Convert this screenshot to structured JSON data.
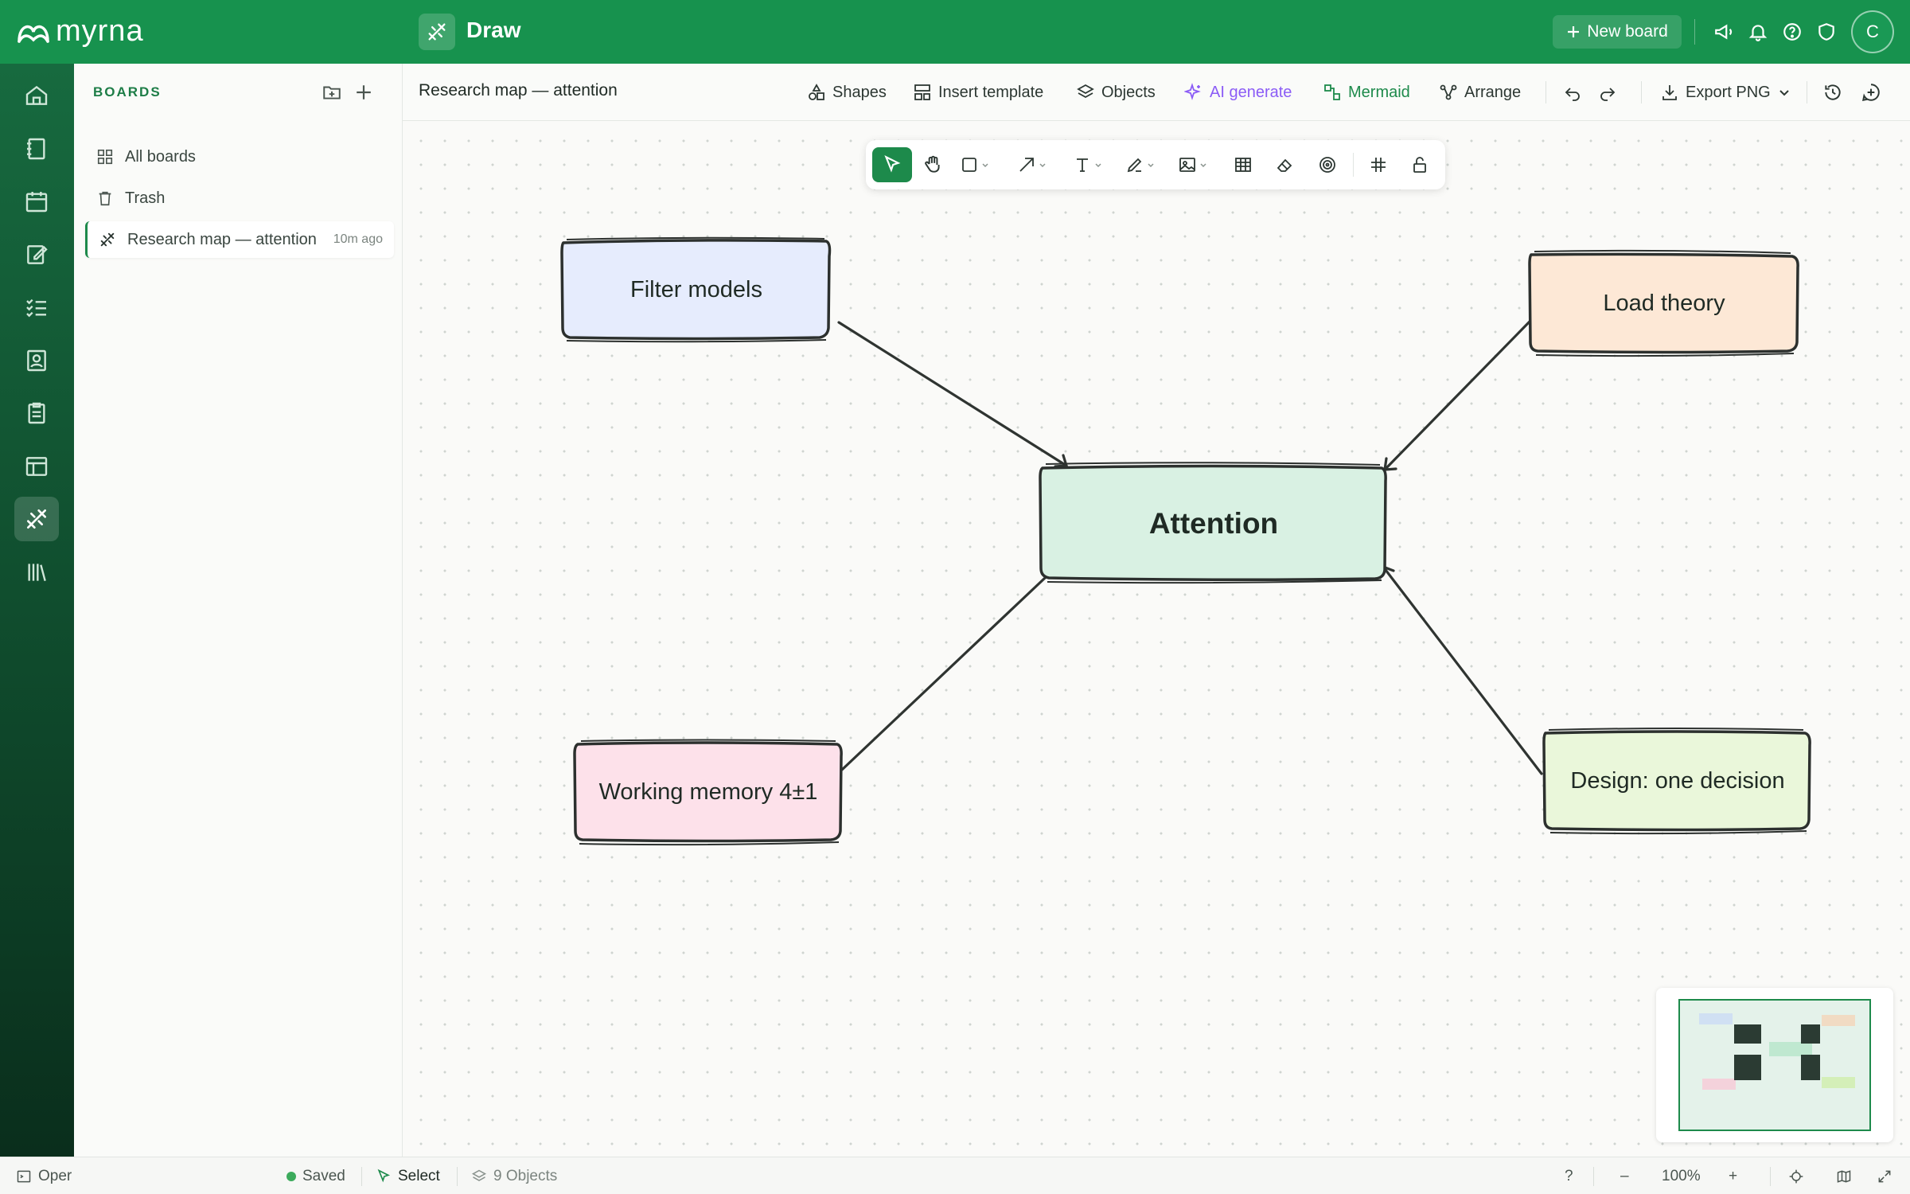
{
  "app": {
    "logo": "myrna",
    "section_title": "Draw"
  },
  "topbar": {
    "new_board_label": "New board",
    "avatar_initial": "C"
  },
  "sidebar": {
    "heading": "BOARDS",
    "items": [
      {
        "label": "All boards",
        "icon": "grid-icon"
      },
      {
        "label": "Trash",
        "icon": "trash-icon"
      },
      {
        "label": "Research map — attention",
        "meta": "10m ago",
        "icon": "draw-icon",
        "active": true
      }
    ]
  },
  "toolbar": {
    "board_title": "Research map — attention",
    "shapes": "Shapes",
    "insert_template": "Insert template",
    "objects": "Objects",
    "ai_generate": "AI generate",
    "mermaid": "Mermaid",
    "arrange": "Arrange",
    "export": "Export PNG"
  },
  "canvas": {
    "nodes": {
      "center": "Attention",
      "top_left": "Filter models",
      "top_right": "Load theory",
      "bottom_left": "Working memory 4±1",
      "bottom_right": "Design: one decision"
    },
    "colors": {
      "center_fill": "#d9f1e3",
      "filter_fill": "#e6ecfd",
      "load_fill": "#fde8d6",
      "memory_fill": "#fde1ea",
      "design_fill": "#eaf7da",
      "stroke": "#2c302e",
      "accent": "#1d8a4b"
    }
  },
  "statusbar": {
    "open_label": "Oper",
    "saved": "Saved",
    "mode": "Select",
    "objects": "9 Objects",
    "help": "?",
    "zoom_out": "–",
    "zoom": "100%",
    "zoom_in": "+"
  }
}
